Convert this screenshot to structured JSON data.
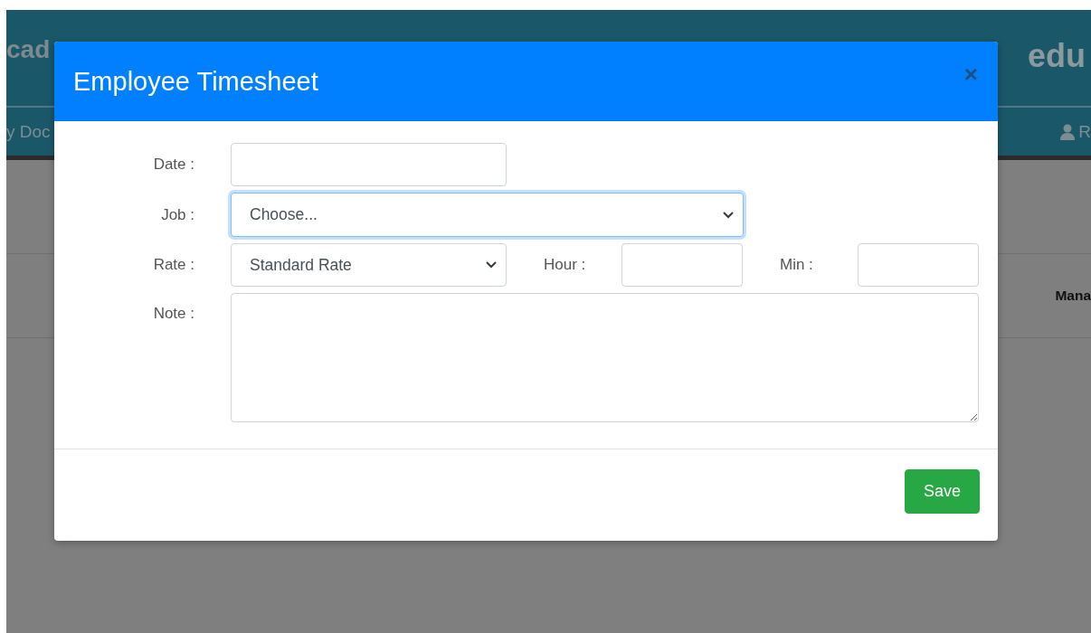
{
  "background": {
    "logo": "cad",
    "logo_right": "edu",
    "nav_left": "y Doc",
    "nav_right": "R",
    "column_heading": "Mana"
  },
  "modal": {
    "title": "Employee Timesheet",
    "close": "×",
    "rows": [
      {
        "items": [
          {
            "kind": "input",
            "label": "Date :",
            "focused": false
          }
        ]
      },
      {
        "items": [
          {
            "kind": "select",
            "label": "Job :",
            "value": "Choose...",
            "focused": true
          }
        ]
      },
      {
        "items": [
          {
            "kind": "select",
            "label": "Rate :",
            "value": "Standard Rate",
            "focused": false
          },
          {
            "kind": "input",
            "label": "Hour :",
            "focused": false
          },
          {
            "kind": "input",
            "label": "Min :",
            "focused": false
          }
        ]
      },
      {
        "items": [
          {
            "kind": "textarea",
            "label": "Note :",
            "focused": false
          }
        ]
      }
    ],
    "save": "Save"
  }
}
